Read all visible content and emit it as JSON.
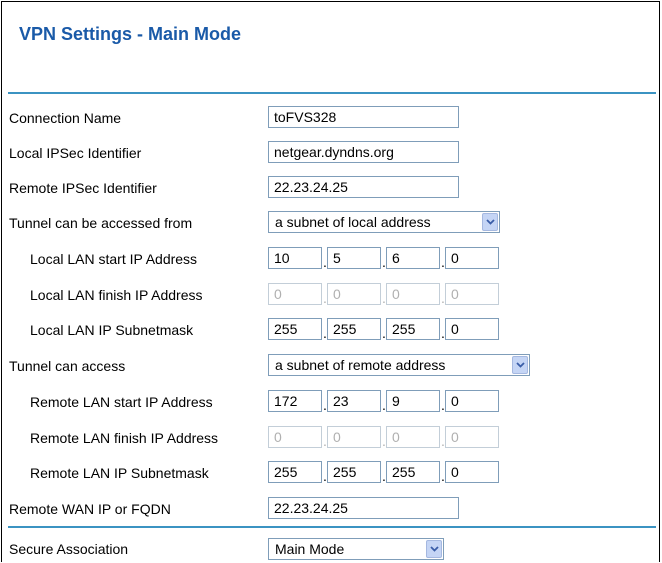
{
  "page": {
    "title": "VPN Settings - Main Mode"
  },
  "form": {
    "connection_name": {
      "label": "Connection Name",
      "value": "toFVS328"
    },
    "local_ipsec_identifier": {
      "label": "Local IPSec Identifier",
      "value": "netgear.dyndns.org"
    },
    "remote_ipsec_identifier": {
      "label": "Remote IPSec Identifier",
      "value": "22.23.24.25"
    },
    "tunnel_accessed_from": {
      "label": "Tunnel can be accessed from",
      "value": "a subnet of local address"
    },
    "local_lan_start_ip": {
      "label": "Local LAN start IP Address",
      "octets": [
        "10",
        "5",
        "6",
        "0"
      ]
    },
    "local_lan_finish_ip": {
      "label": "Local LAN finish IP Address",
      "octets": [
        "0",
        "0",
        "0",
        "0"
      ]
    },
    "local_lan_subnetmask": {
      "label": "Local LAN IP Subnetmask",
      "octets": [
        "255",
        "255",
        "255",
        "0"
      ]
    },
    "tunnel_can_access": {
      "label": "Tunnel can access",
      "value": "a subnet of remote address"
    },
    "remote_lan_start_ip": {
      "label": "Remote LAN start IP Address",
      "octets": [
        "172",
        "23",
        "9",
        "0"
      ]
    },
    "remote_lan_finish_ip": {
      "label": "Remote LAN finish IP Address",
      "octets": [
        "0",
        "0",
        "0",
        "0"
      ]
    },
    "remote_lan_subnetmask": {
      "label": "Remote LAN IP Subnetmask",
      "octets": [
        "255",
        "255",
        "255",
        "0"
      ]
    },
    "remote_wan_ip": {
      "label": "Remote WAN IP or FQDN",
      "value": "22.23.24.25"
    },
    "secure_association": {
      "label": "Secure Association",
      "value": "Main Mode"
    }
  },
  "colors": {
    "title": "#1a5aa8",
    "rule": "#3b93c2",
    "dropdown_button": "#c5d5f5"
  },
  "icons": {
    "dropdown": "chevron-down-icon"
  }
}
